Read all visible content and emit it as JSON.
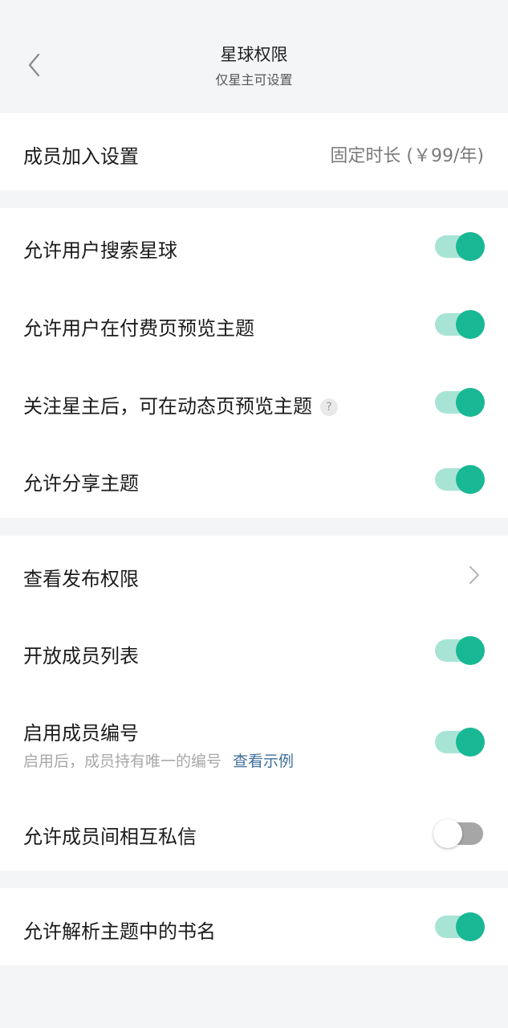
{
  "header": {
    "title": "星球权限",
    "subtitle": "仅星主可设置"
  },
  "membership": {
    "label": "成员加入设置",
    "value": "固定时长 (￥99/年)"
  },
  "group1": [
    {
      "label": "允许用户搜索星球",
      "on": true
    },
    {
      "label": "允许用户在付费页预览主题",
      "on": true
    },
    {
      "label": "关注星主后，可在动态页预览主题",
      "on": true,
      "help": "?"
    },
    {
      "label": "允许分享主题",
      "on": true
    }
  ],
  "group2": {
    "publish_permission": {
      "label": "查看发布权限"
    },
    "member_list": {
      "label": "开放成员列表",
      "on": true
    },
    "member_number": {
      "label": "启用成员编号",
      "sub": "启用后，成员持有唯一的编号",
      "link": "查看示例",
      "on": true
    },
    "private_message": {
      "label": "允许成员间相互私信",
      "on": false
    }
  },
  "group3": {
    "parse_book": {
      "label": "允许解析主题中的书名",
      "on": true
    }
  },
  "colors": {
    "accent": "#19b894",
    "accent_track": "#a8e4d5",
    "link": "#3f6f9c",
    "background": "#f4f5f7"
  }
}
